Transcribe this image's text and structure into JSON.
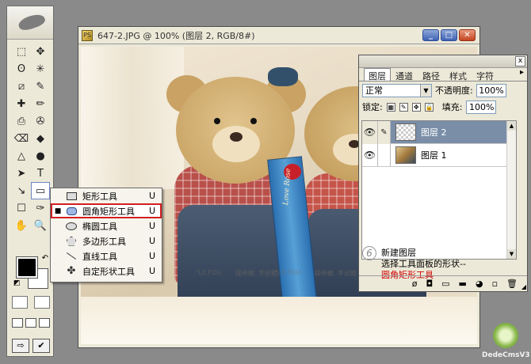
{
  "document": {
    "title": "647-2.JPG @ 100% (图层 2, RGB/8#)",
    "icon_label": "PS",
    "buttons": {
      "minimize": "_",
      "maximize": "□",
      "close": "✕"
    },
    "box_text": "Love Rose",
    "watermarks": [
      "ᴿLE.FOU",
      "操帝榭. 手创館",
      "ᴿLE.FOU",
      "操帝榭. 手创館",
      "ᴿLE.FOU",
      "操帝榭. 手创館",
      "ᴿLE.FOU"
    ]
  },
  "toolbox": {
    "tools": [
      "⬚",
      "✥",
      "ʘ",
      "✳",
      "⧄",
      "✎",
      "✚",
      "✏",
      "⎙",
      "✇",
      "⌫",
      "◆",
      "△",
      "●",
      "➤",
      "T",
      "↘",
      "▭",
      "☐",
      "✑",
      "✋",
      "🔍"
    ],
    "swap_glyph": "↶",
    "reset_glyph": "◩",
    "mode_buttons": [
      "",
      ""
    ],
    "screen_buttons": [
      "",
      "",
      ""
    ],
    "jump_buttons": [
      "⇨",
      "✔"
    ]
  },
  "shape_flyout": {
    "items": [
      {
        "label": "矩形工具",
        "key": "U",
        "icon": "rectangle-icon",
        "selected": false
      },
      {
        "label": "圆角矩形工具",
        "key": "U",
        "icon": "rounded-rectangle-icon",
        "selected": true
      },
      {
        "label": "椭圆工具",
        "key": "U",
        "icon": "ellipse-icon",
        "selected": false
      },
      {
        "label": "多边形工具",
        "key": "U",
        "icon": "polygon-icon",
        "selected": false
      },
      {
        "label": "直线工具",
        "key": "U",
        "icon": "line-icon",
        "selected": false
      },
      {
        "label": "自定形状工具",
        "key": "U",
        "icon": "custom-shape-icon",
        "selected": false
      }
    ],
    "selected_marker": "■",
    "custom_glyph": "✤"
  },
  "layers_panel": {
    "close": "x",
    "tabs": [
      "图层",
      "通道",
      "路径",
      "样式",
      "字符"
    ],
    "active_tab": "图层",
    "more": "▸",
    "blend_mode": "正常",
    "opacity_label": "不透明度:",
    "opacity_value": "100%",
    "lock_label": "锁定:",
    "fill_label": "填充:",
    "fill_value": "100%",
    "lock_icons": [
      "▦",
      "✎",
      "✥",
      "🔒"
    ],
    "layers": [
      {
        "name": "图层 2",
        "active": true,
        "thumb": "transparent",
        "visible_glyph": "👁",
        "brush_glyph": "✎"
      },
      {
        "name": "图层 1",
        "active": false,
        "thumb": "photo",
        "visible_glyph": "👁",
        "brush_glyph": ""
      }
    ],
    "step_number": "6",
    "note_lines": [
      "新建图层",
      "选择工具面板的形状--"
    ],
    "note_highlight": "圆角矩形工具",
    "bottom_icons": [
      "ø",
      "◘",
      "▭",
      "▬",
      "◕",
      "▫",
      "🗑"
    ],
    "scroll_up": "▲",
    "scroll_down": "▼",
    "grip": "◢"
  },
  "logo": {
    "text": "DedeCmsV3"
  }
}
